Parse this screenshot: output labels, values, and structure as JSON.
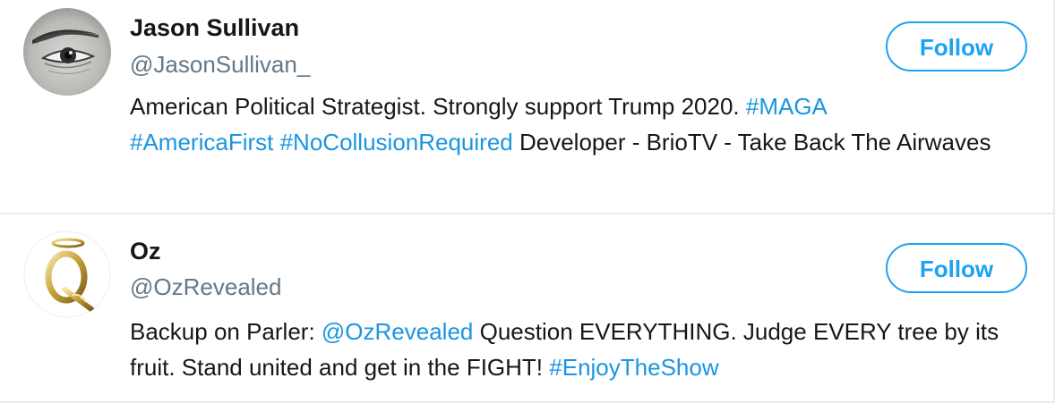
{
  "users": [
    {
      "name": "Jason Sullivan",
      "handle": "@JasonSullivan_",
      "follow_label": "Follow",
      "avatar_icon": "eye-avatar",
      "bio": {
        "t1": "American Political Strategist. Strongly support Trump 2020. ",
        "h1": "#MAGA",
        "h2": "#AmericaFirst",
        "h3": "#NoCollusionRequired",
        "t2": " Developer - BrioTV - Take Back The Airwaves"
      }
    },
    {
      "name": "Oz",
      "handle": "@OzRevealed",
      "follow_label": "Follow",
      "avatar_icon": "gold-q-halo-avatar",
      "bio": {
        "t1": "Backup on Parler: ",
        "m1": "@OzRevealed",
        "t2": " Question EVERYTHING. Judge EVERY tree by its fruit. Stand united and get in the FIGHT! ",
        "h1": "#EnjoyTheShow"
      }
    }
  ],
  "colors": {
    "accent": "#1da1f2",
    "link": "#1b95e0",
    "text": "#14171a",
    "secondary": "#657786",
    "divider": "#e6ecf0"
  }
}
